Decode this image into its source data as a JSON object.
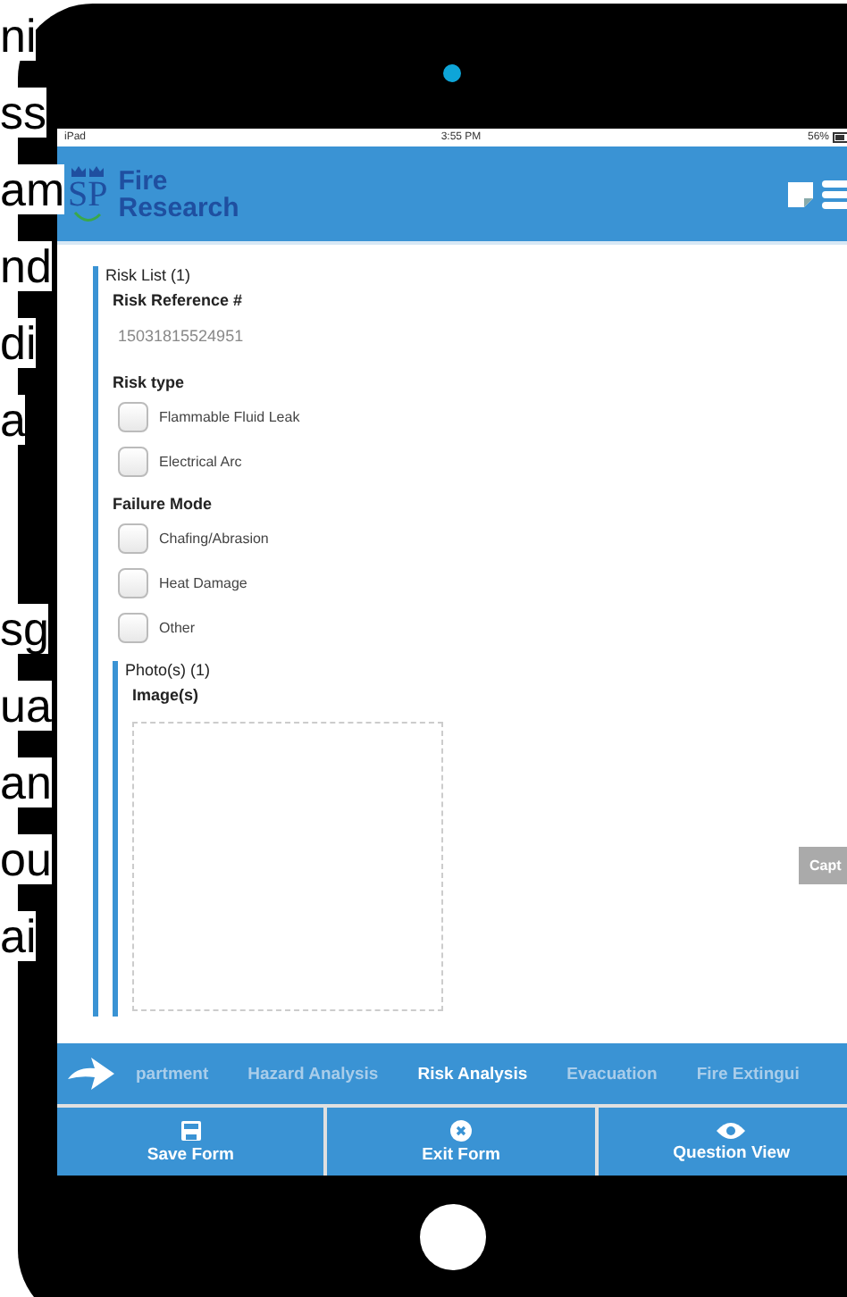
{
  "slide_fragments_upper": [
    "ni",
    "ss",
    "am",
    "nd",
    "di",
    "a"
  ],
  "slide_fragments_lower": [
    "sg",
    "ua",
    "an",
    "ou",
    "ai"
  ],
  "status_bar": {
    "device": "iPad",
    "time": "3:55 PM",
    "battery": "56%"
  },
  "header": {
    "logo": "SP",
    "title_line1": "Fire",
    "title_line2": "Research"
  },
  "risk_list": {
    "legend": "Risk List (1)",
    "reference_label": "Risk Reference #",
    "reference_value": "15031815524951",
    "groups": [
      {
        "label": "Risk type",
        "options": [
          {
            "label": "Flammable Fluid Leak",
            "checked": false
          },
          {
            "label": "Electrical Arc",
            "checked": false
          }
        ]
      },
      {
        "label": "Failure Mode",
        "options": [
          {
            "label": "Chafing/Abrasion",
            "checked": false
          },
          {
            "label": "Heat Damage",
            "checked": false
          },
          {
            "label": "Other",
            "checked": false
          }
        ]
      }
    ],
    "photos": {
      "legend": "Photo(s) (1)",
      "label": "Image(s)",
      "capture_button": "Capt"
    }
  },
  "tabs": [
    {
      "label": "partment",
      "selected": false
    },
    {
      "label": "Hazard Analysis",
      "selected": false
    },
    {
      "label": "Risk Analysis",
      "selected": true
    },
    {
      "label": "Evacuation",
      "selected": false
    },
    {
      "label": "Fire Extingui",
      "selected": false
    }
  ],
  "actions": [
    {
      "kind": "save",
      "label": "Save Form"
    },
    {
      "kind": "exit",
      "label": "Exit Form"
    },
    {
      "kind": "view",
      "label": "Question View"
    }
  ]
}
